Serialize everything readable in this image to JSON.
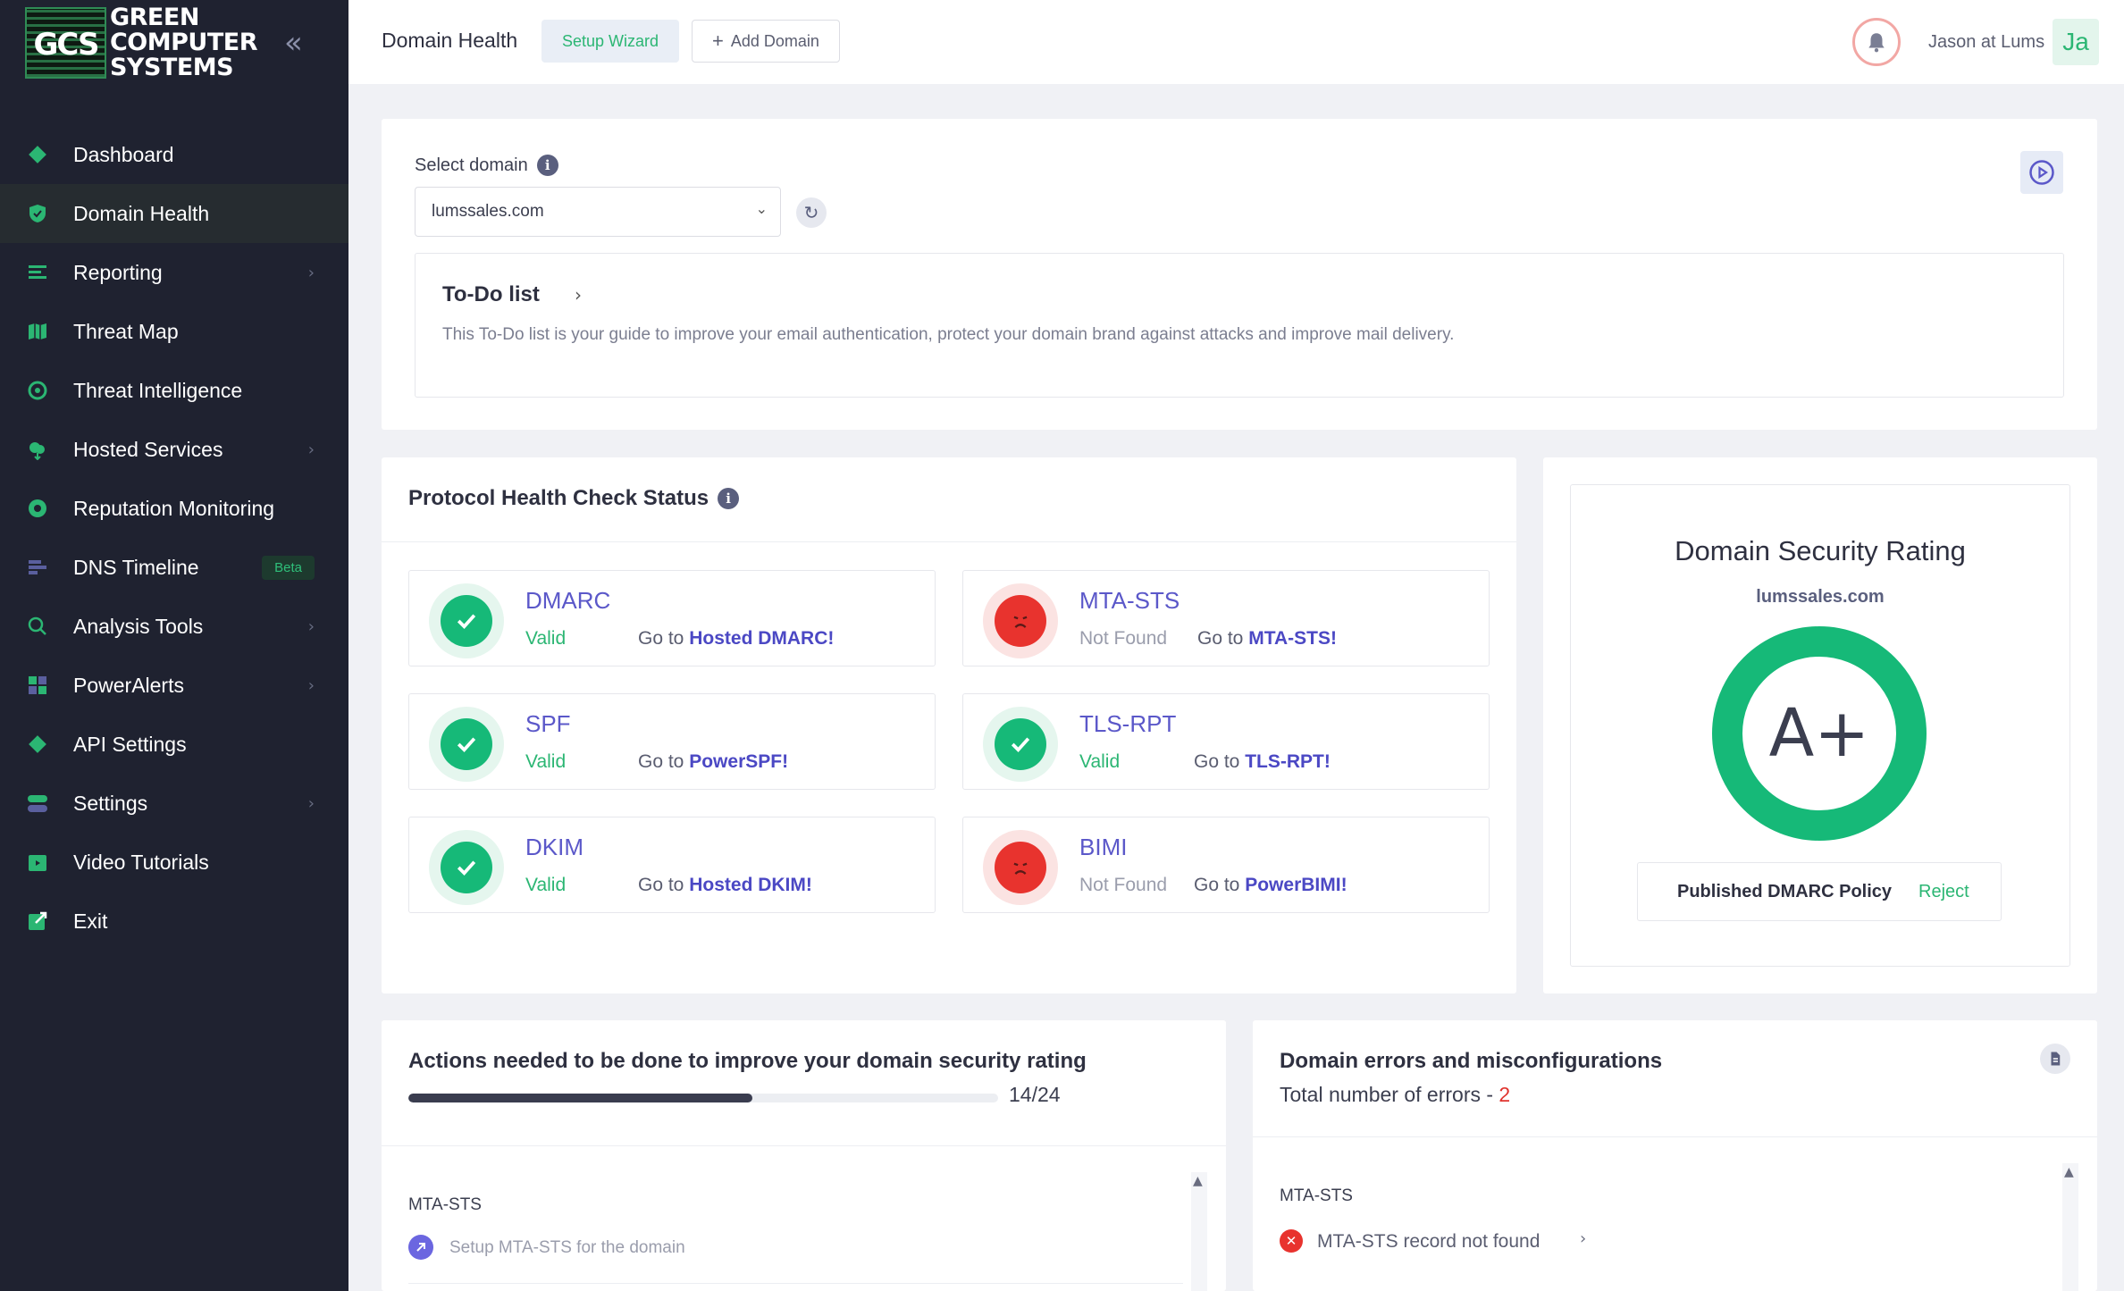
{
  "logo": {
    "mark": "GCS",
    "line1": "GREEN",
    "line2": "COMPUTER",
    "line3": "SYSTEMS"
  },
  "sidebar": {
    "collapse_glyph": "«",
    "items": [
      {
        "label": "Dashboard",
        "icon": "diamond-icon",
        "active": false,
        "chevron": false
      },
      {
        "label": "Domain Health",
        "icon": "shield-check-icon",
        "active": true,
        "chevron": false
      },
      {
        "label": "Reporting",
        "icon": "report-lines-icon",
        "active": false,
        "chevron": true
      },
      {
        "label": "Threat Map",
        "icon": "map-icon",
        "active": false,
        "chevron": false
      },
      {
        "label": "Threat Intelligence",
        "icon": "target-icon",
        "active": false,
        "chevron": false
      },
      {
        "label": "Hosted Services",
        "icon": "cloud-icon",
        "active": false,
        "chevron": true
      },
      {
        "label": "Reputation Monitoring",
        "icon": "badge-icon",
        "active": false,
        "chevron": false
      },
      {
        "label": "DNS Timeline",
        "icon": "timeline-icon",
        "active": false,
        "chevron": false,
        "badge": "Beta"
      },
      {
        "label": "Analysis Tools",
        "icon": "search-icon",
        "active": false,
        "chevron": true
      },
      {
        "label": "PowerAlerts",
        "icon": "grid-icon",
        "active": false,
        "chevron": true
      },
      {
        "label": "API Settings",
        "icon": "diamond-icon",
        "active": false,
        "chevron": false
      },
      {
        "label": "Settings",
        "icon": "toggle-icon",
        "active": false,
        "chevron": true
      },
      {
        "label": "Video Tutorials",
        "icon": "video-icon",
        "active": false,
        "chevron": false
      },
      {
        "label": "Exit",
        "icon": "exit-icon",
        "active": false,
        "chevron": false
      }
    ]
  },
  "topbar": {
    "title": "Domain Health",
    "wizard_label": "Setup Wizard",
    "add_label": "Add Domain",
    "user_name": "Jason at Lums",
    "avatar_initials": "Ja"
  },
  "domain_select": {
    "label": "Select domain",
    "value": "lumssales.com"
  },
  "todo": {
    "title": "To-Do list",
    "description": "This To-Do list is your guide to improve your email authentication, protect your domain brand against attacks and improve mail delivery."
  },
  "protocols": {
    "title": "Protocol Health Check Status",
    "goto_prefix": "Go to",
    "items": [
      {
        "name": "DMARC",
        "status": "Valid",
        "ok": true,
        "link": "Hosted DMARC!"
      },
      {
        "name": "MTA-STS",
        "status": "Not Found",
        "ok": false,
        "link": "MTA-STS!"
      },
      {
        "name": "SPF",
        "status": "Valid",
        "ok": true,
        "link": "PowerSPF!"
      },
      {
        "name": "TLS-RPT",
        "status": "Valid",
        "ok": true,
        "link": "TLS-RPT!"
      },
      {
        "name": "DKIM",
        "status": "Valid",
        "ok": true,
        "link": "Hosted DKIM!"
      },
      {
        "name": "BIMI",
        "status": "Not Found",
        "ok": false,
        "link": "PowerBIMI!"
      }
    ]
  },
  "rating": {
    "title": "Domain Security Rating",
    "domain": "lumssales.com",
    "grade": "A+",
    "policy_label": "Published DMARC Policy",
    "policy_value": "Reject"
  },
  "actions": {
    "title": "Actions needed to be done to improve your domain security rating",
    "progress_text": "14/24",
    "done": 14,
    "total": 24,
    "section": "MTA-STS",
    "item": "Setup MTA-STS for the domain"
  },
  "errors": {
    "title": "Domain errors and misconfigurations",
    "total_label": "Total number of errors - ",
    "total": "2",
    "section": "MTA-STS",
    "item": "MTA-STS record not found"
  },
  "colors": {
    "accent_green": "#16b978",
    "error_red": "#e8332e",
    "link_purple": "#4b48c4",
    "sidebar_bg": "#1f2230"
  }
}
